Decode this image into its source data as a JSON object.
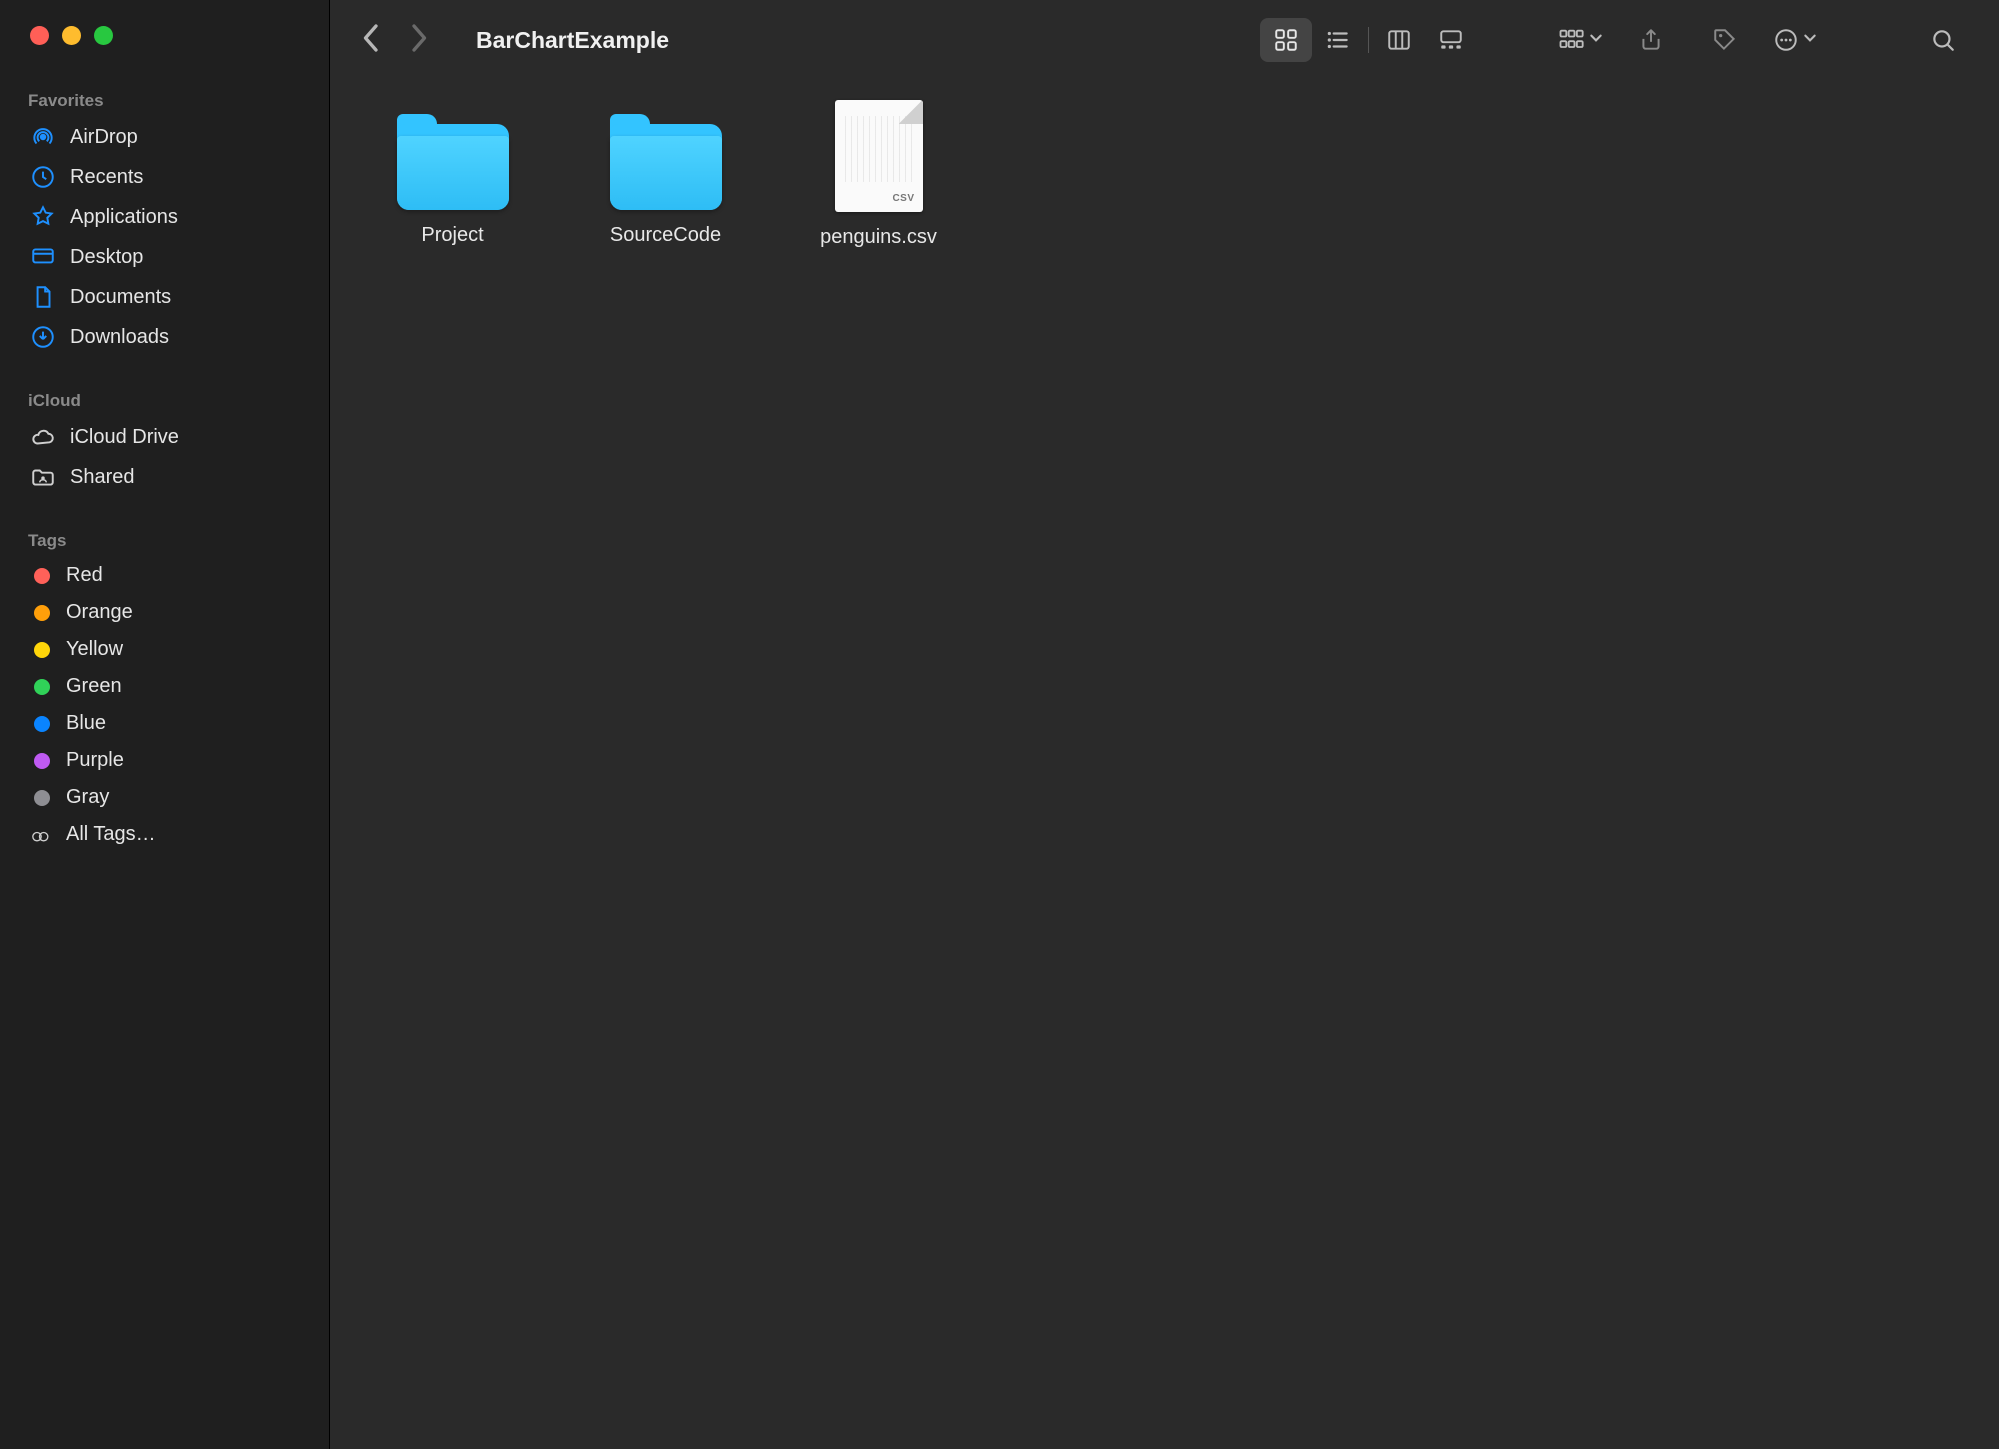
{
  "window": {
    "title": "BarChartExample"
  },
  "sidebar": {
    "sections": {
      "favorites": {
        "header": "Favorites",
        "items": [
          {
            "label": "AirDrop"
          },
          {
            "label": "Recents"
          },
          {
            "label": "Applications"
          },
          {
            "label": "Desktop"
          },
          {
            "label": "Documents"
          },
          {
            "label": "Downloads"
          }
        ]
      },
      "icloud": {
        "header": "iCloud",
        "items": [
          {
            "label": "iCloud Drive"
          },
          {
            "label": "Shared"
          }
        ]
      },
      "tags": {
        "header": "Tags",
        "items": [
          {
            "label": "Red",
            "color": "#ff6159"
          },
          {
            "label": "Orange",
            "color": "#ff9f0a"
          },
          {
            "label": "Yellow",
            "color": "#ffd60a"
          },
          {
            "label": "Green",
            "color": "#30d158"
          },
          {
            "label": "Blue",
            "color": "#0a84ff"
          },
          {
            "label": "Purple",
            "color": "#bf5af2"
          },
          {
            "label": "Gray",
            "color": "#8e8e93"
          }
        ],
        "all_tags_label": "All Tags…"
      }
    }
  },
  "items": [
    {
      "name": "Project",
      "kind": "folder"
    },
    {
      "name": "SourceCode",
      "kind": "folder"
    },
    {
      "name": "penguins.csv",
      "kind": "csv",
      "badge": "CSV"
    }
  ],
  "colors": {
    "accent": "#1e90ff",
    "sidebar_bg": "#1f1f1f",
    "main_bg": "#2a2a2a",
    "folder": "#33c4ff"
  }
}
